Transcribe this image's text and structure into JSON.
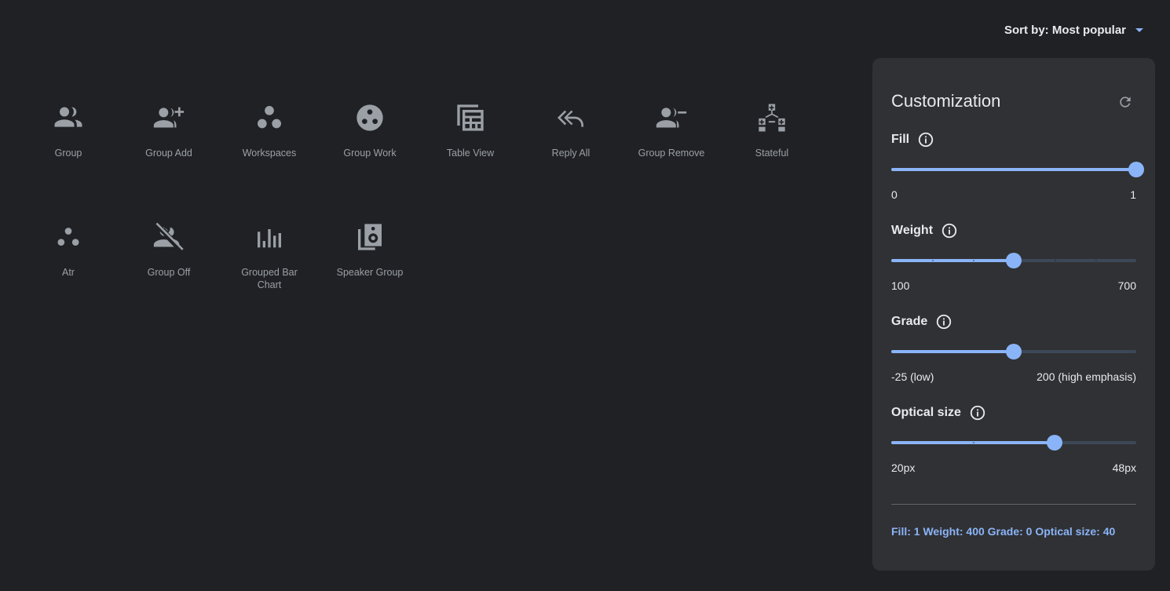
{
  "sort": {
    "label": "Sort by: Most popular",
    "accent": "#8ab4f8"
  },
  "icons": [
    {
      "label": "Group",
      "icon": "group-icon"
    },
    {
      "label": "Group Add",
      "icon": "group-add-icon"
    },
    {
      "label": "Workspaces",
      "icon": "workspaces-icon"
    },
    {
      "label": "Group Work",
      "icon": "group-work-icon"
    },
    {
      "label": "Table View",
      "icon": "table-view-icon"
    },
    {
      "label": "Reply All",
      "icon": "reply-all-icon"
    },
    {
      "label": "Group Remove",
      "icon": "group-remove-icon"
    },
    {
      "label": "Stateful",
      "icon": "stateful-icon"
    },
    {
      "label": "Atr",
      "icon": "atr-icon"
    },
    {
      "label": "Group Off",
      "icon": "group-off-icon"
    },
    {
      "label": "Grouped Bar Chart",
      "icon": "grouped-bar-chart-icon"
    },
    {
      "label": "Speaker Group",
      "icon": "speaker-group-icon"
    }
  ],
  "panel": {
    "title": "Customization",
    "reset_icon": "refresh-icon",
    "sliders": [
      {
        "name": "fill",
        "label": "Fill",
        "min_label": "0",
        "max_label": "1",
        "value_fraction": 1.0,
        "ticks": 0
      },
      {
        "name": "weight",
        "label": "Weight",
        "min_label": "100",
        "max_label": "700",
        "value_fraction": 0.5,
        "ticks": 6
      },
      {
        "name": "grade",
        "label": "Grade",
        "min_label": "-25 (low)",
        "max_label": "200 (high emphasis)",
        "value_fraction": 0.5,
        "ticks": 0
      },
      {
        "name": "optical-size",
        "label": "Optical size",
        "min_label": "20px",
        "max_label": "48px",
        "value_fraction": 0.667,
        "ticks": 3
      }
    ],
    "summary": "Fill: 1 Weight: 400 Grade: 0 Optical size: 40"
  },
  "colors": {
    "background": "#202124",
    "panel": "#303134",
    "icon": "#9aa0a6",
    "accent": "#8ab4f8"
  }
}
